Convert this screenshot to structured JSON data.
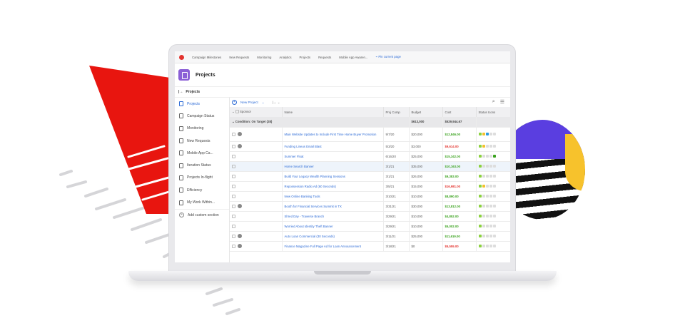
{
  "colors": {
    "accent": "#2d6bd6",
    "brand_red": "#e3342f",
    "purple": "#8b5fd6",
    "green": "#3aa21e"
  },
  "topnav": {
    "items": [
      "Campaign Milestones",
      "New Requests",
      "Monitoring",
      "Analytics",
      "Projects",
      "Requests",
      "Mobile App Awaren..."
    ],
    "pin": "Pin current page"
  },
  "header": {
    "title": "Projects",
    "breadcrumb": "Projects"
  },
  "sidebar": {
    "items": [
      {
        "label": "Projects",
        "active": true
      },
      {
        "label": "Campaign Status"
      },
      {
        "label": "Monitoring"
      },
      {
        "label": "New Requests"
      },
      {
        "label": "Mobile App Ca..."
      },
      {
        "label": "Iteration Status"
      },
      {
        "label": "Projects In-flight"
      },
      {
        "label": "Efficiency"
      },
      {
        "label": "My Work Within..."
      }
    ],
    "add": "Add custom section"
  },
  "toolbar": {
    "new_project": "New Project",
    "icons": [
      "search-icon",
      "filter-icon"
    ]
  },
  "table": {
    "columns": [
      "Sponsor",
      "Name",
      "Proj Comp",
      "Budget",
      "Cost",
      "Status Icons"
    ],
    "group": {
      "label": "Condition: On Target (28)",
      "budget": "$613,000",
      "cost": "$529,944.67"
    },
    "rows": [
      {
        "name": "Main Website Updates to Include First Time Home Buyer Promotion",
        "date": "9/7/20",
        "budget": "$20,000",
        "cost": "$12,846.00",
        "status": "green",
        "avatar": true
      },
      {
        "name": "Funding Lineus Email Blast",
        "date": "5/3/20",
        "budget": "$3,000",
        "cost": "$9,614.00",
        "status": "red",
        "avatar": true
      },
      {
        "name": "Summer Float",
        "date": "6/16/20",
        "budget": "$25,000",
        "cost": "$15,342.00",
        "status": "green"
      },
      {
        "name": "Home Search Banner",
        "date": "3/1/21",
        "budget": "$35,000",
        "cost": "$10,163.00",
        "status": "green",
        "highlight": true
      },
      {
        "name": "Build Your Legacy Wealth Planning Sessions",
        "date": "3/1/21",
        "budget": "$26,000",
        "cost": "$9,383.00",
        "status": "green"
      },
      {
        "name": "Repossession Radio Ad (60 Seconds)",
        "date": "3/5/21",
        "budget": "$15,000",
        "cost": "$16,981.00",
        "status": "red"
      },
      {
        "name": "New Online Banking Tools",
        "date": "3/10/21",
        "budget": "$10,000",
        "cost": "$8,890.00",
        "status": "green"
      },
      {
        "name": "Booth for Financial Services Summit in TX",
        "date": "3/31/21",
        "budget": "$30,000",
        "cost": "$13,812.00",
        "status": "green",
        "avatar": true
      },
      {
        "name": "Shred Day - Traverse Branch",
        "date": "3/29/21",
        "budget": "$10,000",
        "cost": "$4,852.00",
        "status": "green"
      },
      {
        "name": "Worried About Identity Theft Banner",
        "date": "3/29/21",
        "budget": "$10,000",
        "cost": "$5,002.00",
        "status": "green"
      },
      {
        "name": "Auto Loan Commercial (30 Seconds)",
        "date": "3/11/21",
        "budget": "$25,000",
        "cost": "$11,619.00",
        "status": "green",
        "avatar": true
      },
      {
        "name": "Finance Magazine Full Page Ad for Loan Announcement",
        "date": "3/18/21",
        "budget": "$0",
        "cost": "$5,555.00",
        "status": "red",
        "avatar": true
      }
    ]
  }
}
